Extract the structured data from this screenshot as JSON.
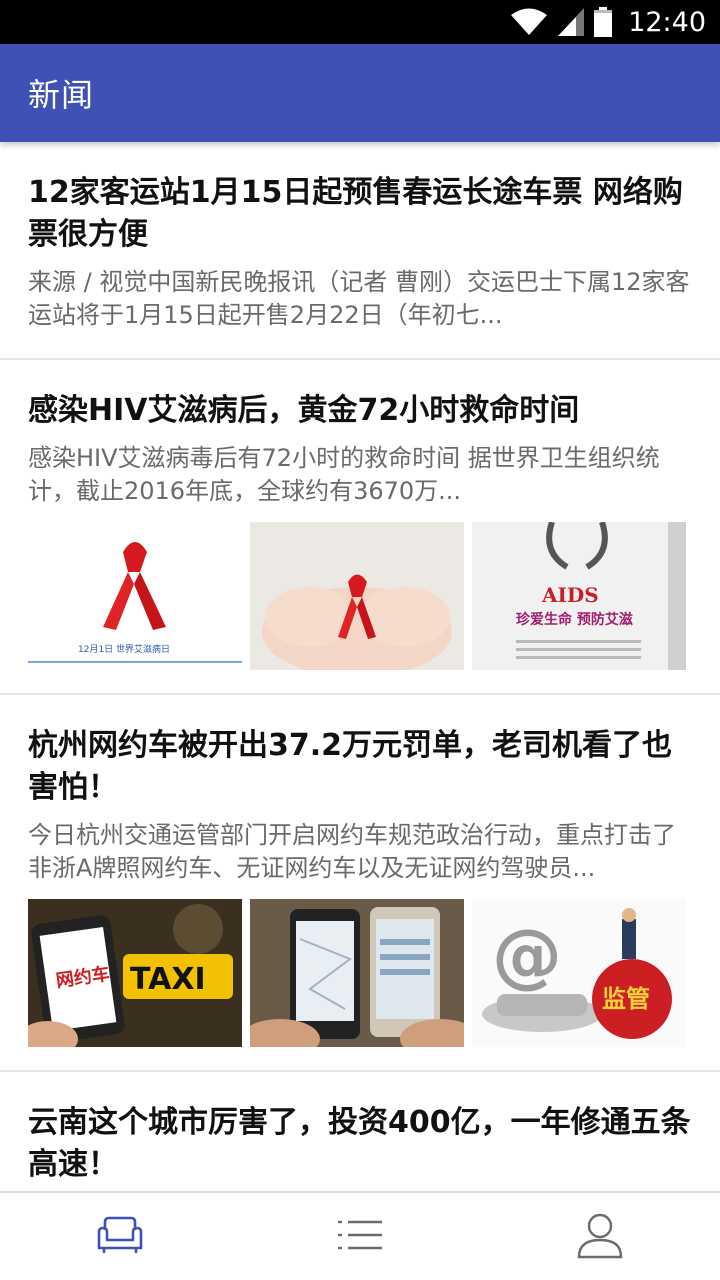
{
  "status_bar": {
    "time": "12:40"
  },
  "app_bar": {
    "title": "新闻"
  },
  "articles": [
    {
      "title": "12家客运站1月15日起预售春运长途车票 网络购票很方便",
      "summary": "来源 / 视觉中国新民晚报讯（记者 曹刚）交运巴士下属12家客运站将于1月15日起开售2月22日（年初七..."
    },
    {
      "title": "感染HIV艾滋病后，黄金72小时救命时间",
      "summary": "感染HIV艾滋病毒后有72小时的救命时间 据世界卫生组织统计，截止2016年底，全球约有3670万...",
      "images": [
        {
          "caption": "12月1日  世界艾滋病日"
        },
        {
          "caption": ""
        },
        {
          "headline": "AIDS",
          "sub": "珍爱生命 预防艾滋"
        }
      ]
    },
    {
      "title": "杭州网约车被开出37.2万元罚单，老司机看了也害怕！",
      "summary": "今日杭州交通运管部门开启网约车规范政治行动，重点打击了非浙A牌照网约车、无证网约车以及无证网约驾驶员...",
      "images": [
        {
          "sign": "TAXI",
          "phone_text": "网约车"
        },
        {
          "caption": ""
        },
        {
          "symbol": "@",
          "stamp": "监管"
        }
      ]
    },
    {
      "title": "云南这个城市厉害了，投资400亿，一年修通五条高速！"
    }
  ],
  "bottom_nav": [
    {
      "icon": "sofa-icon",
      "active": true
    },
    {
      "icon": "list-icon",
      "active": false
    },
    {
      "icon": "user-icon",
      "active": false
    }
  ],
  "colors": {
    "primary": "#3f51b5",
    "active_icon": "#3f51b5",
    "inactive_icon": "#6b6b6b"
  }
}
